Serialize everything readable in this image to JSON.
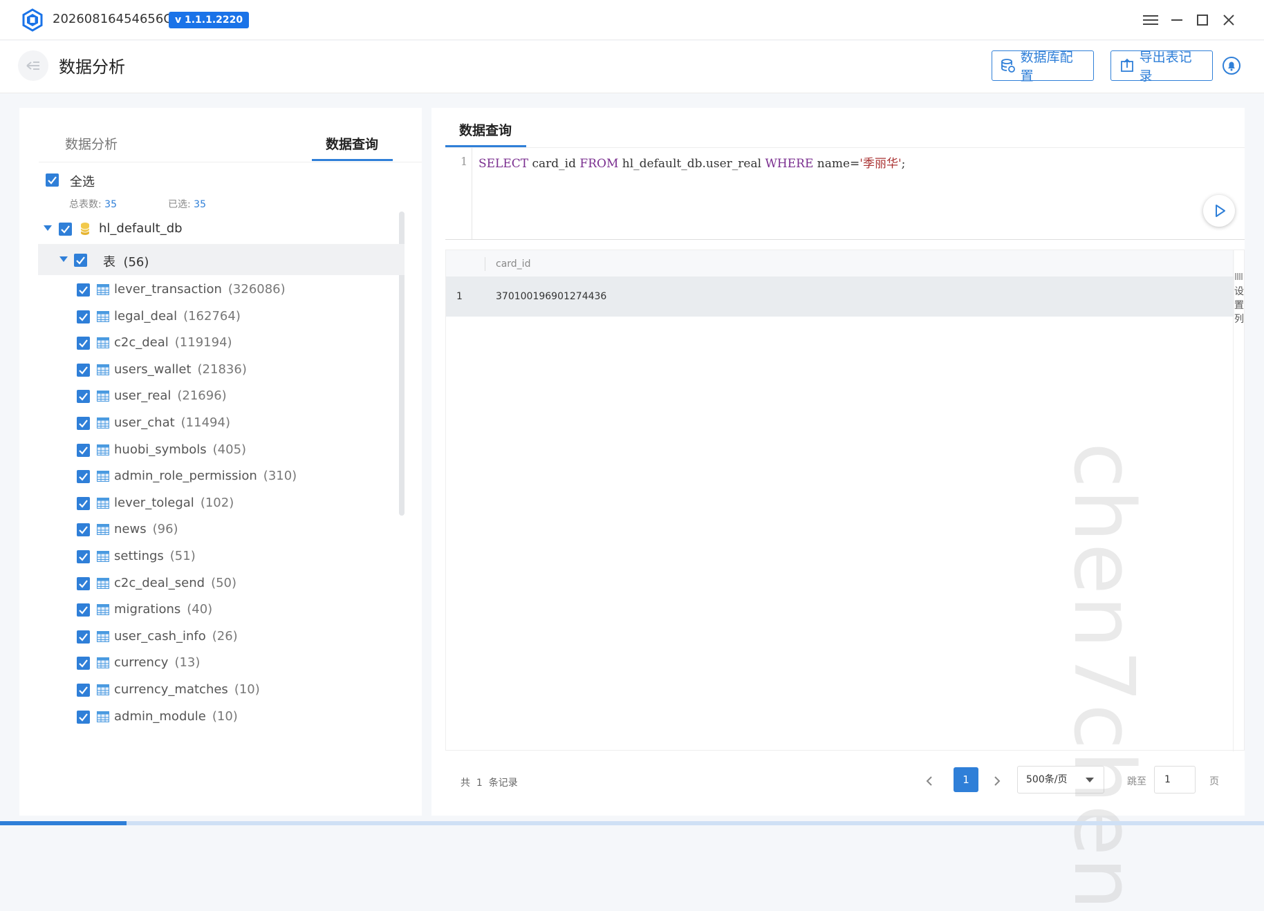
{
  "window": {
    "app_id": "20260816454656C0",
    "version": "v 1.1.1.2220"
  },
  "header": {
    "title": "数据分析",
    "db_config_label": "数据库配置",
    "export_label": "导出表记录"
  },
  "left": {
    "tab_analysis": "数据分析",
    "tab_query": "数据查询",
    "select_all": "全选",
    "total_label": "总表数:",
    "total_value": "35",
    "selected_label": "已选:",
    "selected_value": "35",
    "db_name": "hl_default_db",
    "tables_group": "表  (56)",
    "tables": [
      {
        "name": "lever_transaction",
        "count": "(326086)"
      },
      {
        "name": "legal_deal",
        "count": "(162764)"
      },
      {
        "name": "c2c_deal",
        "count": "(119194)"
      },
      {
        "name": "users_wallet",
        "count": "(21836)"
      },
      {
        "name": "user_real",
        "count": "(21696)"
      },
      {
        "name": "user_chat",
        "count": "(11494)"
      },
      {
        "name": "huobi_symbols",
        "count": "(405)"
      },
      {
        "name": "admin_role_permission",
        "count": "(310)"
      },
      {
        "name": "lever_tolegal",
        "count": "(102)"
      },
      {
        "name": "news",
        "count": "(96)"
      },
      {
        "name": "settings",
        "count": "(51)"
      },
      {
        "name": "c2c_deal_send",
        "count": "(50)"
      },
      {
        "name": "migrations",
        "count": "(40)"
      },
      {
        "name": "user_cash_info",
        "count": "(26)"
      },
      {
        "name": "currency",
        "count": "(13)"
      },
      {
        "name": "currency_matches",
        "count": "(10)"
      },
      {
        "name": "admin_module",
        "count": "(10)"
      }
    ]
  },
  "right": {
    "tab_query": "数据查询",
    "line_no": "1",
    "sql": {
      "kw_select": "SELECT",
      "col": " card_id ",
      "kw_from": "FROM",
      "table": " hl_default_db.user_real ",
      "kw_where": "WHERE",
      "cond": " name=",
      "value": "'季丽华'",
      "end": ";"
    },
    "result_column": "card_id",
    "rows": [
      {
        "index": "1",
        "card_id": "370100196901274436"
      }
    ],
    "column_settings": "设置列",
    "footer": {
      "total_text": "共  1  条记录",
      "current_page": "1",
      "page_size": "500条/页",
      "jump_label": "跳至",
      "jump_value": "1",
      "page_unit": "页"
    }
  },
  "watermark": "chen7chen",
  "colors": {
    "accent": "#2f7fd8",
    "sql_keyword": "#7a2e8f",
    "sql_string": "#aa3333"
  }
}
